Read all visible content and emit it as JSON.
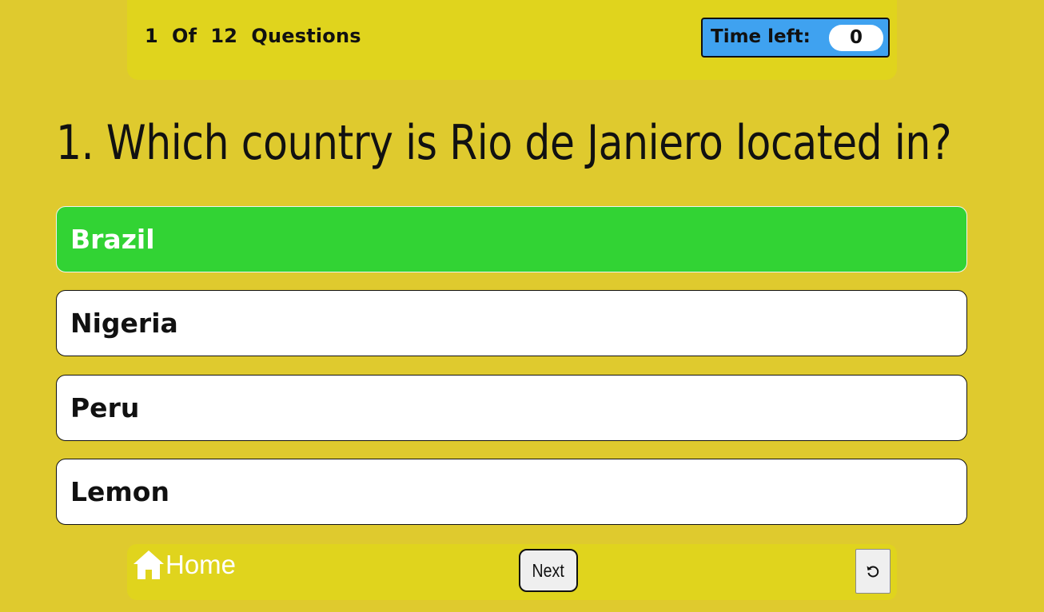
{
  "header": {
    "progress_current": "1",
    "progress_of": "Of",
    "progress_total": "12",
    "progress_label": "Questions",
    "timer_label": "Time left:",
    "timer_value": "0"
  },
  "question": {
    "text": "1. Which country is Rio de Janiero located in?"
  },
  "answers": [
    {
      "label": "Brazil",
      "state": "correct"
    },
    {
      "label": "Nigeria",
      "state": "default"
    },
    {
      "label": "Peru",
      "state": "default"
    },
    {
      "label": "Lemon",
      "state": "default"
    }
  ],
  "footer": {
    "home_label": "Home",
    "home_icon": "home-icon",
    "next_label": "Next",
    "restart_icon": "restart-icon"
  },
  "colors": {
    "page_background": "#dfca2e",
    "bar_background": "#e0d41d",
    "timer_background": "#3fa2f0",
    "correct_answer": "#32d334",
    "answer_background": "#ffffff"
  }
}
